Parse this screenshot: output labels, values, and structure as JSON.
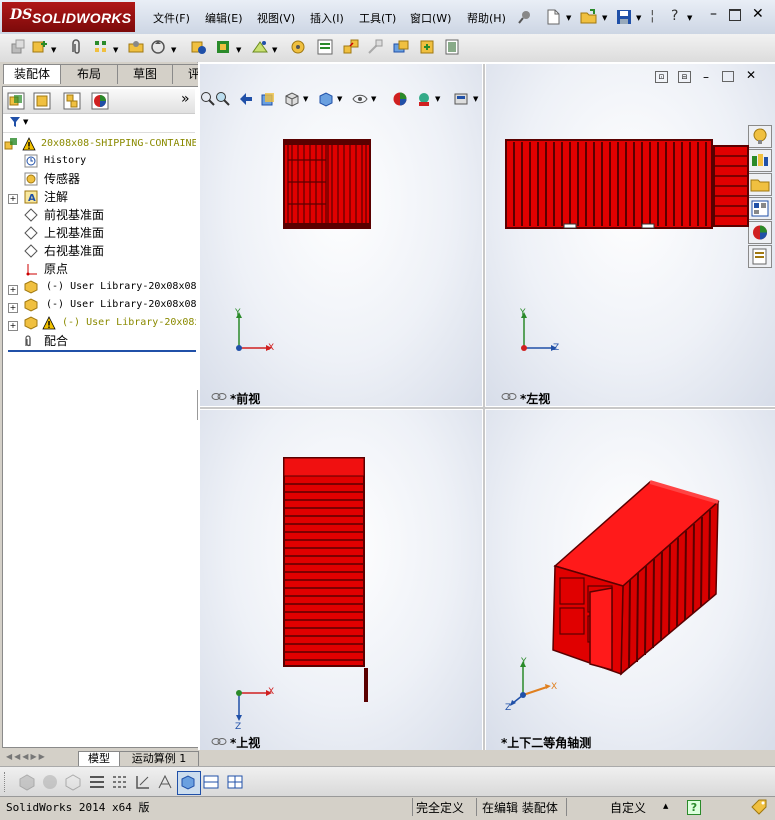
{
  "app": {
    "logo_ds": "DS",
    "logo_text": "SOLIDWORKS"
  },
  "menu": [
    "文件(F)",
    "编辑(E)",
    "视图(V)",
    "插入(I)",
    "工具(T)",
    "窗口(W)",
    "帮助(H)"
  ],
  "left_tabs": [
    "装配体",
    "布局",
    "草图",
    "评估"
  ],
  "tree": {
    "root": "20x08x08-SHIPPING-CONTAINE",
    "items": [
      {
        "label": "History"
      },
      {
        "label": "传感器"
      },
      {
        "label": "注解"
      },
      {
        "label": "前视基准面"
      },
      {
        "label": "上视基准面"
      },
      {
        "label": "右视基准面"
      },
      {
        "label": "原点"
      },
      {
        "label": "(-) User Library-20x08x08-"
      },
      {
        "label": "(-) User Library-20x08x08-"
      },
      {
        "label": "(-) User Library-20x08x"
      },
      {
        "label": "配合"
      }
    ]
  },
  "views": {
    "front": "*前视",
    "left": "*左视",
    "top": "*上视",
    "iso": "*上下二等角轴测"
  },
  "axes": {
    "x": "X",
    "y": "Y",
    "z": "Z"
  },
  "sheet_tabs": [
    "模型",
    "运动算例 1"
  ],
  "status": {
    "version": "SolidWorks 2014 x64 版",
    "defined": "完全定义",
    "editing": "在编辑 装配体",
    "custom": "自定义",
    "help": "?"
  },
  "colors": {
    "container_red": "#e00000",
    "container_dark": "#5a0000",
    "accent": "#b01818",
    "warning": "#f2c200"
  }
}
